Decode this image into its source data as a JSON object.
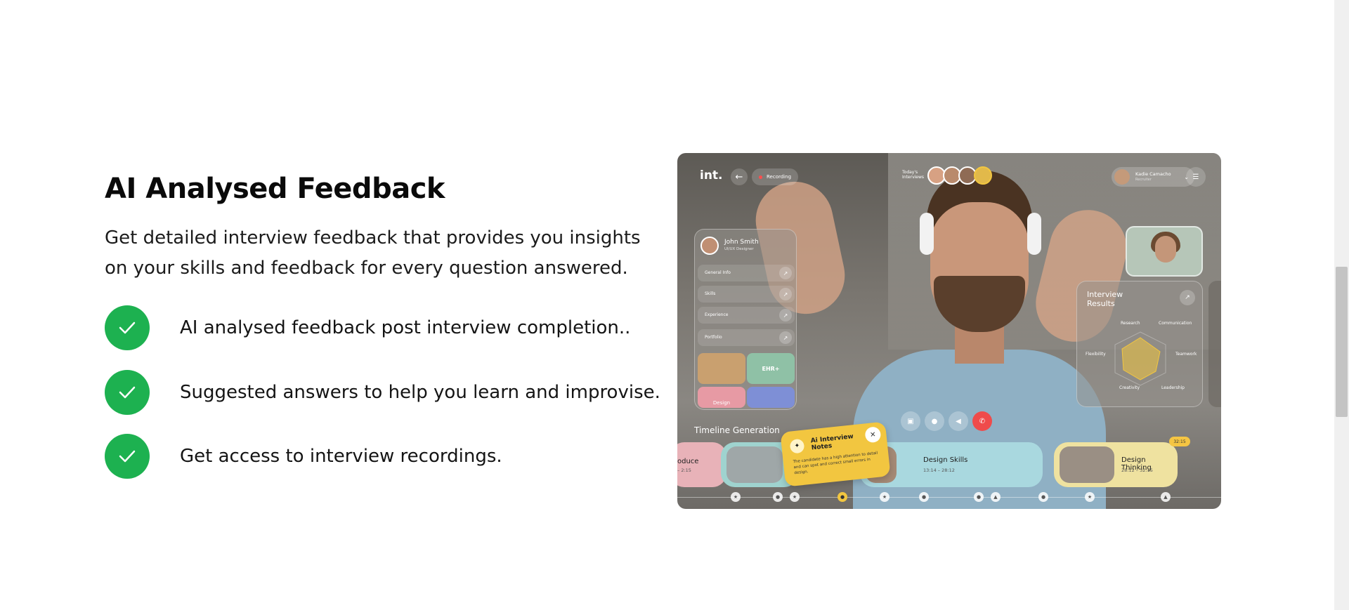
{
  "section": {
    "heading": "AI Analysed Feedback",
    "description": "Get detailed interview feedback that provides you insights on your skills and feedback for every question answered.",
    "features": [
      {
        "text": "AI analysed feedback post interview completion.."
      },
      {
        "text": "Suggested answers to help you learn and improvise."
      },
      {
        "text": "Get access to interview recordings."
      }
    ]
  },
  "colors": {
    "check_green": "#1db150",
    "notes_yellow": "#f2c640",
    "end_call_red": "#ef4b4b"
  },
  "mockup": {
    "logo": "int.",
    "back_icon": "arrow-left-icon",
    "recording_label": "Recording",
    "todays_label": "Today's Interviews",
    "user_name": "Kadie Camacho",
    "user_role": "Recruiter",
    "candidate": {
      "name": "John Smith",
      "role": "UI/UX Designer"
    },
    "profile_rows": [
      "General Info",
      "Skills",
      "Experience",
      "Portfolio"
    ],
    "portfolio_tiles": [
      "EHR+",
      "Design"
    ],
    "results": {
      "title": "Interview Results",
      "labels": [
        "Research",
        "Communication",
        "Teamwork",
        "Leadership",
        "Creativity",
        "Flexibility"
      ]
    },
    "timeline_title": "Timeline Generation",
    "timeline_cards": [
      {
        "name": "oduce",
        "time": "– 2:15"
      },
      {
        "name": "Design Skills",
        "time": "13:14 – 28:12"
      },
      {
        "name": "Design Thinking",
        "time": "28:12 – 32:15"
      }
    ],
    "timeline_badge": "32:15",
    "notes": {
      "title": "Ai Interview Notes",
      "body": "The candidate has a high attention to detail and can spot and correct small errors in design."
    }
  }
}
